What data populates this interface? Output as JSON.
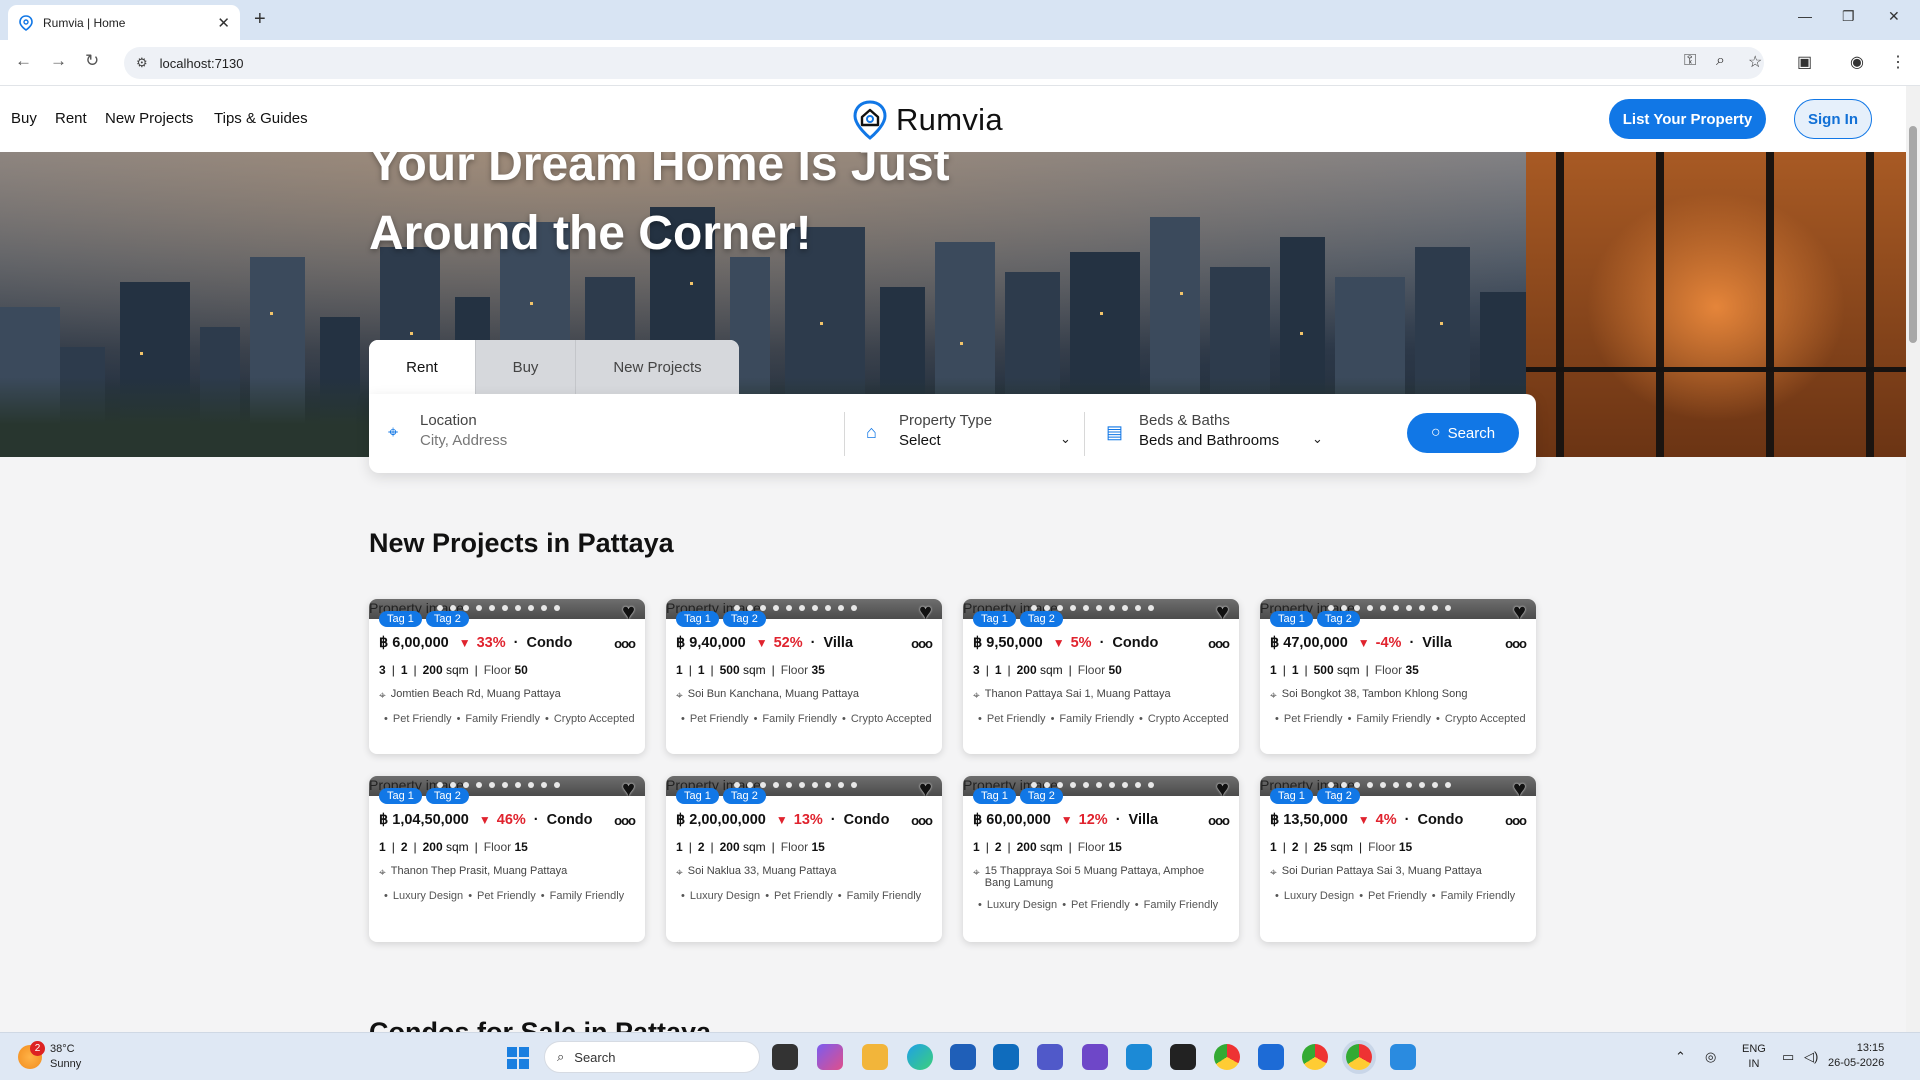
{
  "browser": {
    "tab_title": "Rumvia | Home",
    "url": "localhost:7130"
  },
  "header": {
    "nav": [
      "Buy",
      "Rent",
      "New Projects",
      "Tips & Guides"
    ],
    "logo_text": "Rumvia",
    "list_property": "List Your Property",
    "sign_in": "Sign In"
  },
  "hero": {
    "title_line1": "Your Dream Home Is Just",
    "title_line2": "Around the Corner!"
  },
  "search": {
    "tabs": [
      "Rent",
      "Buy",
      "New Projects"
    ],
    "active_tab": "Rent",
    "location_label": "Location",
    "location_placeholder": "City, Address",
    "type_label": "Property Type",
    "type_value": "Select",
    "beds_label": "Beds & Baths",
    "beds_value": "Beds and Bathrooms",
    "button": "Search"
  },
  "section": {
    "title": "New Projects in Pattaya",
    "next_title": "Condos for Sale in Pattaya"
  },
  "card_common": {
    "image_alt": "Property image",
    "tag1": "Tag 1",
    "tag2": "Tag 2"
  },
  "cards": [
    {
      "price": "฿ 6,00,000",
      "change": "33%",
      "dir": "down",
      "type": "Condo",
      "beds": "3",
      "baths": "1",
      "area": "200",
      "unit": "sqm",
      "floor_label": "Floor",
      "floor": "50",
      "address": "Jomtien Beach Rd, Muang Pattaya",
      "features": [
        "Pet Friendly",
        "Family Friendly",
        "Crypto Accepted"
      ]
    },
    {
      "price": "฿ 9,40,000",
      "change": "52%",
      "dir": "down",
      "type": "Villa",
      "beds": "1",
      "baths": "1",
      "area": "500",
      "unit": "sqm",
      "floor_label": "Floor",
      "floor": "35",
      "address": "Soi Bun Kanchana, Muang Pattaya",
      "features": [
        "Pet Friendly",
        "Family Friendly",
        "Crypto Accepted"
      ]
    },
    {
      "price": "฿ 9,50,000",
      "change": "5%",
      "dir": "down",
      "type": "Condo",
      "beds": "3",
      "baths": "1",
      "area": "200",
      "unit": "sqm",
      "floor_label": "Floor",
      "floor": "50",
      "address": "Thanon Pattaya Sai 1, Muang Pattaya",
      "features": [
        "Pet Friendly",
        "Family Friendly",
        "Crypto Accepted"
      ]
    },
    {
      "price": "฿ 47,00,000",
      "change": "-4%",
      "dir": "down",
      "type": "Villa",
      "beds": "1",
      "baths": "1",
      "area": "500",
      "unit": "sqm",
      "floor_label": "Floor",
      "floor": "35",
      "address": "Soi Bongkot 38, Tambon Khlong Song",
      "features": [
        "Pet Friendly",
        "Family Friendly",
        "Crypto Accepted"
      ]
    },
    {
      "price": "฿ 1,04,50,000",
      "change": "46%",
      "dir": "down",
      "type": "Condo",
      "beds": "1",
      "baths": "2",
      "area": "200",
      "unit": "sqm",
      "floor_label": "Floor",
      "floor": "15",
      "address": "Thanon Thep Prasit, Muang Pattaya",
      "features": [
        "Luxury Design",
        "Pet Friendly",
        "Family Friendly"
      ]
    },
    {
      "price": "฿ 2,00,00,000",
      "change": "13%",
      "dir": "down",
      "type": "Condo",
      "beds": "1",
      "baths": "2",
      "area": "200",
      "unit": "sqm",
      "floor_label": "Floor",
      "floor": "15",
      "address": "Soi Naklua 33, Muang Pattaya",
      "features": [
        "Luxury Design",
        "Pet Friendly",
        "Family Friendly"
      ]
    },
    {
      "price": "฿ 60,00,000",
      "change": "12%",
      "dir": "down",
      "type": "Villa",
      "beds": "1",
      "baths": "2",
      "area": "200",
      "unit": "sqm",
      "floor_label": "Floor",
      "floor": "15",
      "address": "15 Thappraya Soi 5 Muang Pattaya, Amphoe Bang Lamung",
      "features": [
        "Luxury Design",
        "Pet Friendly",
        "Family Friendly"
      ]
    },
    {
      "price": "฿ 13,50,000",
      "change": "4%",
      "dir": "down",
      "type": "Condo",
      "beds": "1",
      "baths": "2",
      "area": "25",
      "unit": "sqm",
      "floor_label": "Floor",
      "floor": "15",
      "address": "Soi Durian Pattaya Sai 3, Muang Pattaya",
      "features": [
        "Luxury Design",
        "Pet Friendly",
        "Family Friendly"
      ]
    }
  ],
  "taskbar": {
    "temp": "38°C",
    "weather": "Sunny",
    "badge": "2",
    "search": "Search",
    "lang1": "ENG",
    "lang2": "IN",
    "time": "13:15",
    "date": "26-05-2026"
  },
  "colors": {
    "brand": "#1177e6",
    "price_down": "#e0232e"
  }
}
